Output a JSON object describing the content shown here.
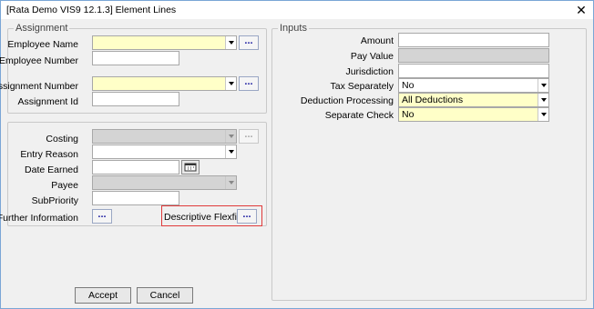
{
  "window": {
    "title": "[Rata Demo VIS9 12.1.3] Element Lines",
    "close_glyph": "✕"
  },
  "assignment": {
    "legend": "Assignment",
    "employee_name_label": "Employee Name",
    "employee_name_value": "",
    "employee_number_label": "Employee Number",
    "employee_number_value": "",
    "assignment_number_label": "Assignment Number",
    "assignment_number_value": "",
    "assignment_id_label": "Assignment Id",
    "assignment_id_value": "",
    "lov_glyph": "..."
  },
  "details": {
    "costing_label": "Costing",
    "entry_reason_label": "Entry Reason",
    "date_earned_label": "Date Earned",
    "payee_label": "Payee",
    "subpriority_label": "SubPriority",
    "further_info_label": "Further Information",
    "descriptive_flexfield_label": "Descriptive Flexfield"
  },
  "inputs": {
    "legend": "Inputs",
    "amount_label": "Amount",
    "amount_value": "",
    "pay_value_label": "Pay Value",
    "pay_value_value": "",
    "jurisdiction_label": "Jurisdiction",
    "jurisdiction_value": "",
    "tax_separately_label": "Tax Separately",
    "tax_separately_value": "No",
    "deduction_processing_label": "Deduction Processing",
    "deduction_processing_value": "All Deductions",
    "separate_check_label": "Separate Check",
    "separate_check_value": "No"
  },
  "buttons": {
    "accept_label": "Accept",
    "cancel_label": "Cancel"
  },
  "colors": {
    "required_field": "#ffffc8",
    "disabled_field": "#d4d4d4",
    "highlight_border": "#e03a3a"
  }
}
